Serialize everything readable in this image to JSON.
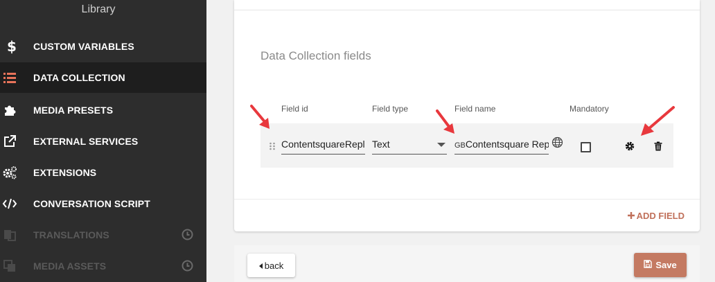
{
  "sidebar": {
    "title": "Library",
    "items": [
      {
        "label": "CUSTOM VARIABLES",
        "icon": "dollar-icon",
        "state": "normal"
      },
      {
        "label": "DATA COLLECTION",
        "icon": "list-icon",
        "state": "active"
      },
      {
        "label": "MEDIA PRESETS",
        "icon": "puzzle-icon",
        "state": "normal"
      },
      {
        "label": "EXTERNAL SERVICES",
        "icon": "external-link-icon",
        "state": "normal"
      },
      {
        "label": "EXTENSIONS",
        "icon": "gears-icon",
        "state": "normal"
      },
      {
        "label": "CONVERSATION SCRIPT",
        "icon": "code-icon",
        "state": "normal"
      },
      {
        "label": "TRANSLATIONS",
        "icon": "translate-icon",
        "state": "disabled"
      },
      {
        "label": "MEDIA ASSETS",
        "icon": "copy-icon",
        "state": "disabled"
      }
    ]
  },
  "section": {
    "title": "Data Collection fields",
    "columns": {
      "field_id": "Field id",
      "field_type": "Field type",
      "field_name": "Field name",
      "mandatory": "Mandatory"
    },
    "rows": [
      {
        "field_id": "ContentsquareReplay",
        "field_type": "Text",
        "lang_prefix": "GB",
        "field_name": "Contentsquare Replay",
        "mandatory": false
      }
    ],
    "add_field_label": "ADD FIELD"
  },
  "footer": {
    "back_label": "back",
    "save_label": "Save"
  },
  "colors": {
    "sidebar_bg": "#2d2d2d",
    "active_bg": "#1e1e1e",
    "accent": "#c47a62",
    "annotation_arrow": "#e8383d"
  }
}
